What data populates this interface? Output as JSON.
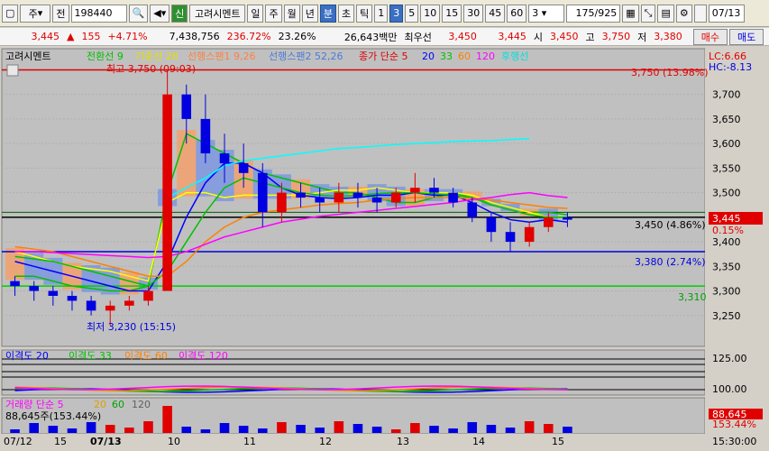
{
  "toolbar": {
    "market_label": "주",
    "code_type": "전",
    "code_value": "198440",
    "tag_label": "신",
    "stock_name": "고려시멘트",
    "period_day": "일",
    "period_week": "주",
    "period_month": "월",
    "period_year": "년",
    "period_minute": "분",
    "period_tick": "초",
    "period_tick2": "틱",
    "minutes": [
      "1",
      "3",
      "5",
      "10",
      "15",
      "30",
      "45",
      "60"
    ],
    "minute_selected": "3",
    "interval_value": "3",
    "count_value": "175",
    "count_total": "/925",
    "date_value": "07/13"
  },
  "quote": {
    "price": "3,445",
    "change": "155",
    "change_pct": "+4.71%",
    "volume": "7,438,756",
    "vol_ratio": "236.72%",
    "turnover": "23.26%",
    "amount": "26,643백만",
    "best_label": "최우선",
    "ask": "3,450",
    "bid": "3,445",
    "open_label": "시",
    "open": "3,450",
    "high_label": "고",
    "high": "3,750",
    "low_label": "저",
    "low": "3,380",
    "buy_label": "매수",
    "sell_label": "매도"
  },
  "legend": {
    "name": "고려시멘트",
    "tenkan": "전환선 9",
    "kijun": "기준선 26",
    "senkou1": "선행스팬1 9,26",
    "senkou2": "선행스팬2 52,26",
    "close_ma": "종가 단순 5",
    "ma20": "20",
    "ma33": "33",
    "ma60": "60",
    "ma120": "120",
    "lagging": "후행선",
    "lc": "LC:6.66",
    "hc": "HC:-8.13"
  },
  "annotations": {
    "high_mark": "최고 3,750 (09:03)",
    "low_mark": "최저 3,230 (15:15)",
    "line_3750": "3,750 (13.98%)",
    "line_3450": "3,450 (4.86%)",
    "line_3380": "3,380 (2.74%)",
    "line_3310": "3,310",
    "cur_price": "3,445",
    "cur_pct": "0.15%"
  },
  "price_axis": [
    "3,700",
    "3,650",
    "3,600",
    "3,550",
    "3,500",
    "3,450",
    "3,400",
    "3,350",
    "3,300",
    "3,250"
  ],
  "disparity": {
    "labels": [
      "이격도 20",
      "이격도 33",
      "이격도 60",
      "이격도 120"
    ],
    "axis": [
      "125.00",
      "100.00"
    ]
  },
  "volume_panel": {
    "title": "거래량 단순 5",
    "ma20": "20",
    "ma60": "60",
    "ma120": "120",
    "value": "88,645주(153.44%)",
    "cur": "88,645",
    "cur_pct": "153.44%"
  },
  "x_axis": [
    "07/12",
    "15",
    "07/13",
    "10",
    "11",
    "12",
    "13",
    "14",
    "15"
  ],
  "time_label": "15:30:00",
  "colors": {
    "up": "#e00000",
    "down": "#0000e0",
    "tenkan": "#00c000",
    "kijun": "#ffff00",
    "ma5": "#e00000",
    "ma20": "#0000ff",
    "ma33": "#00c000",
    "ma60": "#ff8000",
    "ma120": "#ff00ff",
    "lagging": "#00ffff"
  },
  "chart_data": {
    "type": "candlestick",
    "ylim": [
      3200,
      3760
    ],
    "series": [
      {
        "name": "전환선 9",
        "values": [
          3330,
          3330,
          3320,
          3310,
          3305,
          3300,
          3300,
          3310,
          3500,
          3620,
          3600,
          3580,
          3560,
          3540,
          3530,
          3520,
          3510,
          3500,
          3500,
          3490,
          3480,
          3480,
          3490,
          3500,
          3490,
          3480,
          3470,
          3460,
          3460,
          3455
        ]
      },
      {
        "name": "기준선 26",
        "values": [
          3380,
          3370,
          3360,
          3350,
          3345,
          3340,
          3330,
          3320,
          3480,
          3500,
          3500,
          3490,
          3495,
          3495,
          3495,
          3495,
          3500,
          3505,
          3505,
          3510,
          3505,
          3500,
          3500,
          3500,
          3495,
          3480,
          3470,
          3460,
          3450,
          3450
        ]
      },
      {
        "name": "20",
        "values": [
          3360,
          3350,
          3340,
          3330,
          3320,
          3310,
          3300,
          3300,
          3360,
          3450,
          3520,
          3560,
          3560,
          3540,
          3510,
          3495,
          3490,
          3488,
          3490,
          3495,
          3495,
          3500,
          3495,
          3495,
          3480,
          3460,
          3445,
          3440,
          3445,
          3440
        ]
      },
      {
        "name": "33",
        "values": [
          3370,
          3365,
          3360,
          3350,
          3340,
          3330,
          3320,
          3310,
          3340,
          3400,
          3460,
          3510,
          3530,
          3520,
          3510,
          3500,
          3495,
          3492,
          3495,
          3498,
          3500,
          3500,
          3498,
          3495,
          3490,
          3475,
          3465,
          3455,
          3450,
          3450
        ]
      },
      {
        "name": "60",
        "values": [
          3390,
          3385,
          3380,
          3370,
          3360,
          3350,
          3340,
          3330,
          3330,
          3360,
          3400,
          3430,
          3450,
          3460,
          3465,
          3470,
          3475,
          3478,
          3480,
          3485,
          3488,
          3490,
          3490,
          3490,
          3488,
          3485,
          3480,
          3475,
          3470,
          3468
        ]
      },
      {
        "name": "120",
        "values": [
          3380,
          3380,
          3378,
          3376,
          3374,
          3372,
          3370,
          3368,
          3370,
          3380,
          3395,
          3410,
          3420,
          3430,
          3440,
          3446,
          3452,
          3456,
          3460,
          3464,
          3468,
          3472,
          3476,
          3480,
          3486,
          3490,
          3496,
          3500,
          3494,
          3490
        ]
      },
      {
        "name": "후행선",
        "values": [
          null,
          null,
          null,
          null,
          null,
          null,
          null,
          null,
          3490,
          3510,
          3530,
          3555,
          3565,
          3570,
          3575,
          3580,
          3585,
          3590,
          3592,
          3595,
          3598,
          3600,
          3602,
          3604,
          3605,
          3606,
          3608,
          3610
        ]
      }
    ],
    "candles": [
      [
        3320,
        3330,
        3290,
        3310
      ],
      [
        3310,
        3320,
        3280,
        3300
      ],
      [
        3300,
        3310,
        3270,
        3290
      ],
      [
        3290,
        3300,
        3260,
        3280
      ],
      [
        3280,
        3290,
        3250,
        3260
      ],
      [
        3260,
        3280,
        3230,
        3270
      ],
      [
        3270,
        3290,
        3260,
        3280
      ],
      [
        3280,
        3310,
        3270,
        3300
      ],
      [
        3300,
        3750,
        3300,
        3700
      ],
      [
        3700,
        3720,
        3600,
        3650
      ],
      [
        3650,
        3700,
        3560,
        3580
      ],
      [
        3580,
        3620,
        3520,
        3560
      ],
      [
        3560,
        3600,
        3510,
        3540
      ],
      [
        3540,
        3560,
        3430,
        3460
      ],
      [
        3460,
        3520,
        3440,
        3500
      ],
      [
        3500,
        3520,
        3470,
        3490
      ],
      [
        3490,
        3510,
        3460,
        3480
      ],
      [
        3480,
        3520,
        3460,
        3500
      ],
      [
        3500,
        3520,
        3470,
        3490
      ],
      [
        3490,
        3510,
        3460,
        3480
      ],
      [
        3480,
        3510,
        3470,
        3500
      ],
      [
        3500,
        3540,
        3480,
        3510
      ],
      [
        3510,
        3530,
        3490,
        3500
      ],
      [
        3500,
        3510,
        3470,
        3480
      ],
      [
        3480,
        3490,
        3440,
        3450
      ],
      [
        3450,
        3460,
        3400,
        3420
      ],
      [
        3420,
        3440,
        3380,
        3400
      ],
      [
        3400,
        3440,
        3390,
        3430
      ],
      [
        3430,
        3460,
        3420,
        3450
      ],
      [
        3450,
        3460,
        3430,
        3445
      ]
    ]
  }
}
